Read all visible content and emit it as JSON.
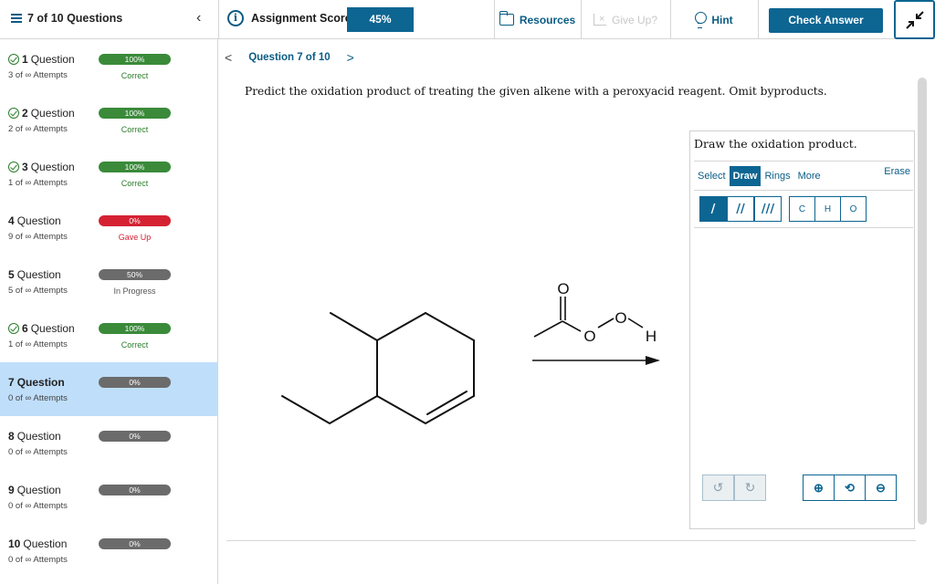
{
  "topbar": {
    "progress_label": "7 of 10 Questions",
    "score_label": "Assignment Score:",
    "score_value": "45%",
    "resources_label": "Resources",
    "giveup_label": "Give Up?",
    "hint_label": "Hint",
    "check_answer_label": "Check Answer",
    "collapse_icon": "collapse-arrows-icon"
  },
  "sidebar": {
    "questions": [
      {
        "label": "Question",
        "num": "1",
        "attempts": "3 of ∞ Attempts",
        "percent": "100%",
        "status": "Correct",
        "color": "green",
        "checked": true
      },
      {
        "label": "Question",
        "num": "2",
        "attempts": "2 of ∞ Attempts",
        "percent": "100%",
        "status": "Correct",
        "color": "green",
        "checked": true
      },
      {
        "label": "Question",
        "num": "3",
        "attempts": "1 of ∞ Attempts",
        "percent": "100%",
        "status": "Correct",
        "color": "green",
        "checked": true
      },
      {
        "label": "Question",
        "num": "4",
        "attempts": "9 of ∞ Attempts",
        "percent": "0%",
        "status": "Gave Up",
        "color": "red",
        "checked": false
      },
      {
        "label": "Question",
        "num": "5",
        "attempts": "5 of ∞ Attempts",
        "percent": "50%",
        "status": "In Progress",
        "color": "grey",
        "checked": false
      },
      {
        "label": "Question",
        "num": "6",
        "attempts": "1 of ∞ Attempts",
        "percent": "100%",
        "status": "Correct",
        "color": "green",
        "checked": true
      },
      {
        "label": "Question",
        "num": "7",
        "attempts": "0 of ∞ Attempts",
        "percent": "0%",
        "status": "",
        "color": "grey",
        "checked": false
      },
      {
        "label": "Question",
        "num": "8",
        "attempts": "0 of ∞ Attempts",
        "percent": "0%",
        "status": "",
        "color": "grey",
        "checked": false
      },
      {
        "label": "Question",
        "num": "9",
        "attempts": "0 of ∞ Attempts",
        "percent": "0%",
        "status": "",
        "color": "grey",
        "checked": false
      },
      {
        "label": "Question",
        "num": "10",
        "attempts": "0 of ∞ Attempts",
        "percent": "0%",
        "status": "",
        "color": "grey",
        "checked": false
      }
    ]
  },
  "main": {
    "nav_label": "Question 7 of 10",
    "prompt": "Predict the oxidation product of treating the given alkene with a peroxyacid reagent. Omit byproducts."
  },
  "reagent": {
    "oxygen_top": "O",
    "oxygen_1": "O",
    "oxygen_2": "O",
    "hydrogen": "H"
  },
  "draw_panel": {
    "title": "Draw the oxidation product.",
    "tabs": [
      "Select",
      "Draw",
      "Rings",
      "More"
    ],
    "erase_label": "Erase",
    "bonds": [
      "/",
      "//",
      "///"
    ],
    "atoms": [
      "C",
      "H",
      "O"
    ],
    "undo_icon": "↺",
    "redo_icon": "↻",
    "zoom_in_icon": "⊕",
    "zoom_reset_icon": "⟲",
    "zoom_out_icon": "⊖"
  },
  "colors": {
    "accent": "#0d6592",
    "correct": "#3a8a3a",
    "gave_up": "#d42233",
    "active_row": "#bfdefa"
  }
}
